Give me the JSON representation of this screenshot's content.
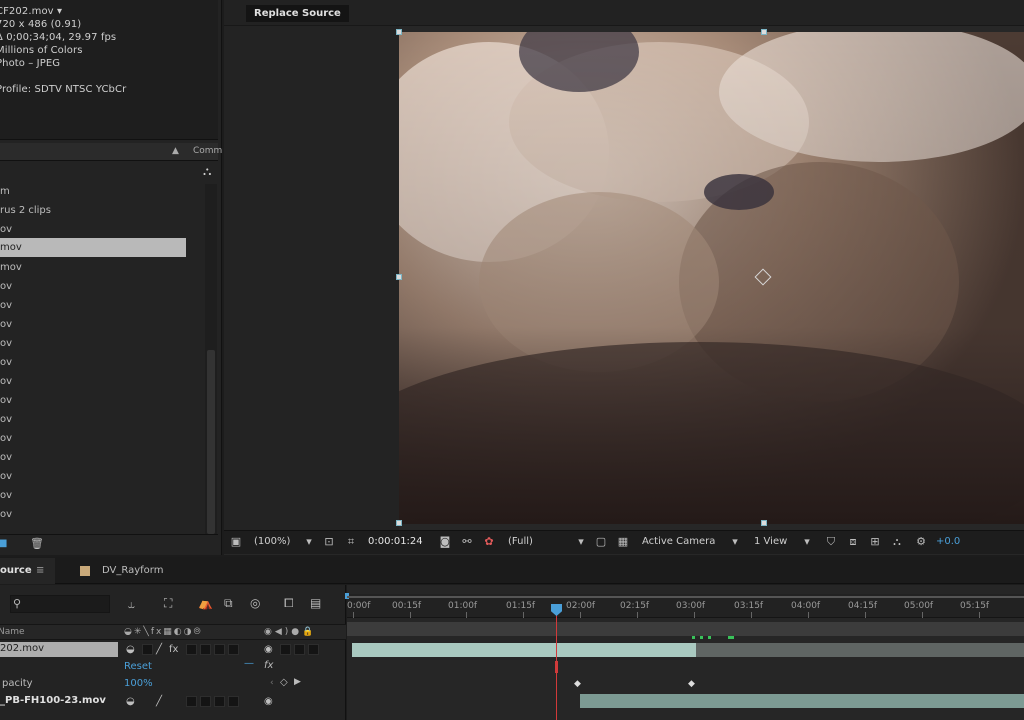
{
  "project": {
    "info_lines": [
      "CF202.mov ▾",
      "720 x 486 (0.91)",
      "Δ 0;00;34;04, 29.97 fps",
      "Millions of Colors",
      "Photo – JPEG",
      "",
      "Profile: SDTV NTSC YCbCr"
    ],
    "header_label": "Comm",
    "items": [
      "m",
      "rus 2 clips",
      "ov",
      "mov",
      "mov",
      "ov",
      "ov",
      "ov",
      "ov",
      "ov",
      "ov",
      "ov",
      "ov",
      "ov",
      "ov",
      "ov",
      "ov",
      "ov",
      "ov"
    ],
    "selected_index": 3
  },
  "viewer": {
    "tab_label": "Replace Source",
    "zoom": "(100%)",
    "timecode": "0:00:01:24",
    "resolution": "(Full)",
    "camera": "Active Camera",
    "views": "1 View",
    "exposure": "+0.0"
  },
  "timeline": {
    "active_tab": "ource",
    "other_tab": "DV_Rayform",
    "column_name": "Name",
    "ruler_labels": [
      "0:00f",
      "00:15f",
      "01:00f",
      "01:15f",
      "02:00f",
      "02:15f",
      "03:00f",
      "03:15f",
      "04:00f",
      "04:15f",
      "05:00f",
      "05:15f"
    ],
    "layers": [
      {
        "name": "202.mov"
      },
      {
        "name": "Reset",
        "value": "",
        "is_reset": true
      },
      {
        "name": "pacity",
        "value": "100%"
      },
      {
        "name": "_PB-FH100-23.mov"
      }
    ],
    "colors": {
      "accent": "#4a9fd8",
      "playhead": "#d13a3a",
      "track": "#a9c9c0"
    }
  }
}
